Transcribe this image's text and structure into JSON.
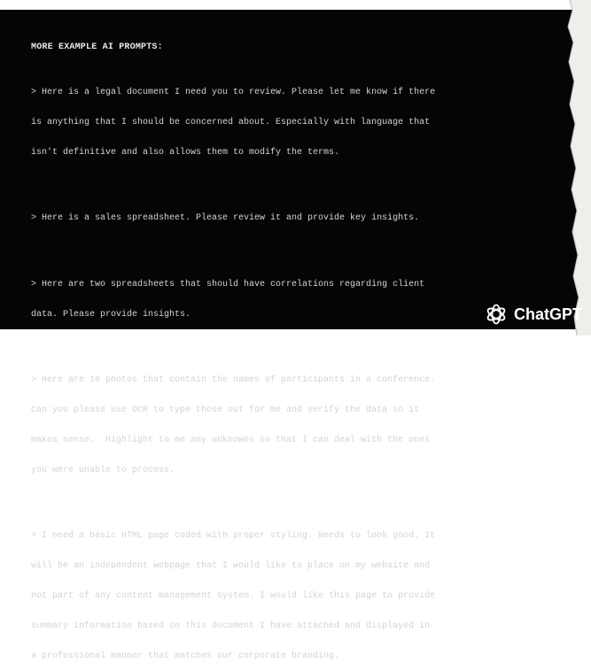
{
  "heading": "MORE EXAMPLE AI PROMPTS:",
  "prompts": [
    {
      "lines": [
        "> Here is a legal document I need you to review. Please let me know if there",
        "is anything that I should be concerned about. Especially with language that",
        "isn't definitive and also allows them to modify the terms."
      ]
    },
    {
      "lines": [
        "> Here is a sales spreadsheet. Please review it and provide key insights."
      ]
    },
    {
      "lines": [
        "> Here are two spreadsheets that should have correlations regarding client",
        "data. Please provide insights."
      ]
    },
    {
      "lines": [
        "> Here are 10 photos that contain the names of participants in a conference.",
        "Can you please use OCR to type those out for me and verify the data so it",
        "makes sense.  Highlight to me any unknowns so that I can deal with the ones",
        "you were unable to process."
      ]
    },
    {
      "lines": [
        "> I need a basic HTML page coded with proper styling. Needs to look good. It",
        "will be an independent webpage that I would like to place on my website and",
        "not part of any content management system. I would like this page to provide",
        "summary information based on this document I have attached and displayed in",
        "a professional manner that matches our corporate branding."
      ]
    }
  ],
  "brand": {
    "name": "ChatGPT",
    "icon": "openai-logo-icon"
  },
  "colors": {
    "background": "#050505",
    "text": "#d4d4d4",
    "page": "#ffffff"
  }
}
